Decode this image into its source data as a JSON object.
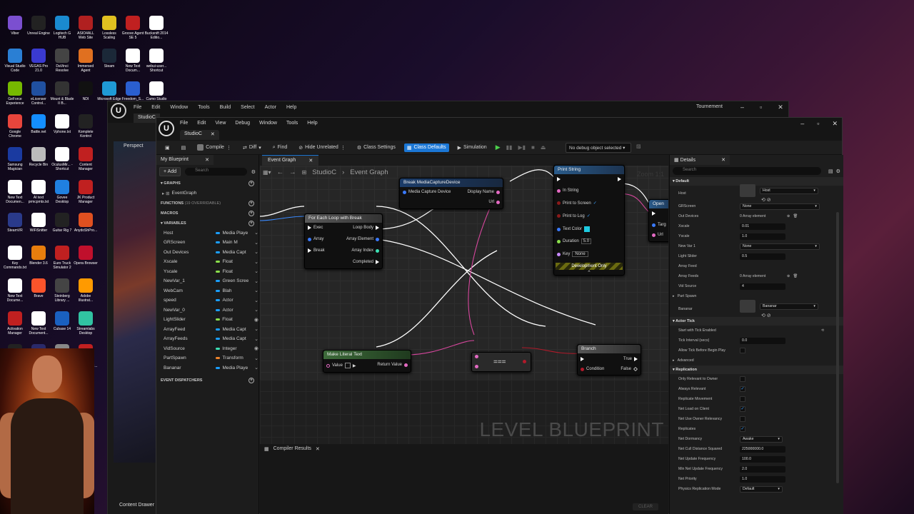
{
  "desktop": {
    "icons": [
      {
        "label": "Viber",
        "color": "#7b4fd0"
      },
      {
        "label": "Unreal Engine",
        "color": "#222222"
      },
      {
        "label": "Logitech G HUB",
        "color": "#1a8ad0"
      },
      {
        "label": "ASIO4ALL Web Site",
        "color": "#b02020"
      },
      {
        "label": "Lossless Scaling",
        "color": "#e0c020"
      },
      {
        "label": "Groove Agent SE 5",
        "color": "#c02020"
      },
      {
        "label": "Bucksnift 2014 Editio...",
        "color": "#ffffff"
      },
      {
        "label": "Visual Studio Code",
        "color": "#2a7fd4"
      },
      {
        "label": "VEGAS Pro 21.0",
        "color": "#3a3ad0"
      },
      {
        "label": "DaVinci Resolve",
        "color": "#444444"
      },
      {
        "label": "Immersed Agent",
        "color": "#e07020"
      },
      {
        "label": "Steam",
        "color": "#1b2838"
      },
      {
        "label": "New Text Docum...",
        "color": "#ffffff"
      },
      {
        "label": "webui-user... Shortcut",
        "color": "#ffffff"
      },
      {
        "label": "GeForce Experience",
        "color": "#76b900"
      },
      {
        "label": "eLicenser Control...",
        "color": "#2050a0"
      },
      {
        "label": "Mount & Blade II B...",
        "color": "#333333"
      },
      {
        "label": "NDI",
        "color": "#111111"
      },
      {
        "label": "Microsoft Edge",
        "color": "#1f9ad6"
      },
      {
        "label": "Freedom_S... Shortcut",
        "color": "#2a5fd0"
      },
      {
        "label": "Camo Studio",
        "color": "#ffffff"
      },
      {
        "label": "Google Chrome",
        "color": "#e8453c"
      },
      {
        "label": "Battle.net",
        "color": "#148eff"
      },
      {
        "label": "Vphone.txt",
        "color": "#ffffff"
      },
      {
        "label": "Komplete Kontrol",
        "color": "#222222"
      },
      {
        "label": "Samsung Magician",
        "color": "#1a3aa0"
      },
      {
        "label": "Recycle Bin",
        "color": "#bbbbbb"
      },
      {
        "label": "OculusMir... - Shortcut",
        "color": "#ffffff"
      },
      {
        "label": "Content Manager",
        "color": "#c02020"
      },
      {
        "label": "New Text Documen...",
        "color": "#ffffff"
      },
      {
        "label": "AI text prmcpmts.txt",
        "color": "#ffffff"
      },
      {
        "label": "Govee Desktop",
        "color": "#2080e0"
      },
      {
        "label": "JK Product Manager",
        "color": "#c02020"
      },
      {
        "label": "SteamVR",
        "color": "#2a3a8a"
      },
      {
        "label": "WiFiSnitter",
        "color": "#ffffff"
      },
      {
        "label": "Guitar Rig 7",
        "color": "#222222"
      },
      {
        "label": "AnydoShPro...",
        "color": "#e05020"
      },
      {
        "label": "Key Commands.txt",
        "color": "#ffffff"
      },
      {
        "label": "Blender 3.6",
        "color": "#e87d0d"
      },
      {
        "label": "Euro Truck Simulator 2",
        "color": "#c02020"
      },
      {
        "label": "Opera Browser",
        "color": "#c0102c"
      },
      {
        "label": "New Text Docume...",
        "color": "#ffffff"
      },
      {
        "label": "Brave",
        "color": "#fb542b"
      },
      {
        "label": "Steinberg Library ...",
        "color": "#444444"
      },
      {
        "label": "Adobe Illustrat...",
        "color": "#ff9a00"
      },
      {
        "label": "Activation Manager",
        "color": "#c02020"
      },
      {
        "label": "New Text Document...",
        "color": "#ffffff"
      },
      {
        "label": "Cubase 14",
        "color": "#1a60c0"
      },
      {
        "label": "Streamlabs Desktop",
        "color": "#31c3a2"
      },
      {
        "label": "Archetype Petrucci X",
        "color": "#222222"
      },
      {
        "label": "Elgato Control...",
        "color": "#2a2a6a"
      },
      {
        "label": "IMG_5059.H...",
        "color": "#888888"
      },
      {
        "label": "SOUND FORGE Audi...",
        "color": "#c02020"
      }
    ]
  },
  "back_window": {
    "menu": [
      "File",
      "Edit",
      "Window",
      "Tools",
      "Build",
      "Select",
      "Actor",
      "Help"
    ],
    "title": "Tournement",
    "tab": "StudioC",
    "viewport_label": "Perspect",
    "content_drawer": "Content Drawer"
  },
  "window": {
    "menu": [
      "File",
      "Edit",
      "View",
      "Debug",
      "Window",
      "Tools",
      "Help"
    ],
    "tab": "StudioC",
    "toolbar": {
      "compile": "Compile",
      "diff": "Diff",
      "find": "Find",
      "hide_unrelated": "Hide Unrelated",
      "class_settings": "Class Settings",
      "class_defaults": "Class Defaults",
      "simulation": "Simulation",
      "debug_object": "No debug object selected"
    }
  },
  "my_blueprint": {
    "tab": "My Blueprint",
    "add": "+ Add",
    "search_placeholder": "Search",
    "graphs_header": "GRAPHS",
    "event_graph": "EventGraph",
    "functions_header": "FUNCTIONS",
    "functions_note": "(19 OVERRIDABLE)",
    "macros_header": "MACROS",
    "variables_header": "VARIABLES",
    "dispatchers_header": "EVENT DISPATCHERS",
    "variables": [
      {
        "name": "Host",
        "type": "Media Playe",
        "color": "#1a9fff",
        "eye": "⌄"
      },
      {
        "name": "GRScreen",
        "type": "Main M",
        "color": "#1a9fff",
        "eye": "⌄"
      },
      {
        "name": "Out Devices",
        "type": "Media Capt",
        "color": "#1a9fff",
        "eye": "⌄"
      },
      {
        "name": "Xscale",
        "type": "Float",
        "color": "#8be04c",
        "eye": "⌄"
      },
      {
        "name": "Yscale",
        "type": "Float",
        "color": "#8be04c",
        "eye": "⌄"
      },
      {
        "name": "NewVar_1",
        "type": "Green Scree",
        "color": "#1a9fff",
        "eye": "⌄"
      },
      {
        "name": "WebCam",
        "type": "Blah",
        "color": "#1a9fff",
        "eye": "⌄"
      },
      {
        "name": "speed",
        "type": "Actor",
        "color": "#1a9fff",
        "eye": "⌄"
      },
      {
        "name": "NewVar_0",
        "type": "Actor",
        "color": "#1a9fff",
        "eye": "⌄"
      },
      {
        "name": "LightSlider",
        "type": "Float",
        "color": "#8be04c",
        "eye": "◉"
      },
      {
        "name": "ArrayFeed",
        "type": "Media Capt",
        "color": "#1a9fff",
        "eye": "⌄"
      },
      {
        "name": "ArrayFeeds",
        "type": "Media Capt",
        "color": "#1a9fff",
        "eye": "⌄"
      },
      {
        "name": "VidSource",
        "type": "Integer",
        "color": "#3ce0b4",
        "eye": "◉"
      },
      {
        "name": "PartSpawn",
        "type": "Transform",
        "color": "#f0842c",
        "eye": "⌄"
      },
      {
        "name": "Bananar",
        "type": "Media Playe",
        "color": "#1a9fff",
        "eye": "⌄"
      }
    ]
  },
  "graph": {
    "tab": "Event Graph",
    "breadcrumb_root": "StudioC",
    "breadcrumb_leaf": "Event Graph",
    "zoom": "Zoom 1:1",
    "level_blueprint": "LEVEL BLUEPRINT",
    "nodes": {
      "break_media": {
        "title": "Break MediaCaptureDevice",
        "in": "Media Capture Device",
        "out1": "Display Name",
        "out2": "Url"
      },
      "for_each": {
        "title": "For Each Loop with Break",
        "in1": "Exec",
        "in2": "Array",
        "in3": "Break",
        "out1": "Loop Body",
        "out2": "Array Element",
        "out3": "Array Index",
        "out4": "Completed"
      },
      "print_string": {
        "title": "Print String",
        "in_string": "In String",
        "print_screen": "Print to Screen",
        "print_log": "Print to Log",
        "text_color": "Text Color",
        "duration": "Duration",
        "duration_val": "5.0",
        "key": "Key",
        "key_val": "None",
        "dev_only": "Development Only"
      },
      "open": {
        "title": "Open",
        "sub": "Targ",
        "pin1": "Targ",
        "pin2": "Url"
      },
      "make_literal": {
        "title": "Make Literal Text",
        "in": "Value",
        "out": "Return Value"
      },
      "equal": {
        "label": "==="
      },
      "branch": {
        "title": "Branch",
        "cond": "Condition",
        "true": "True",
        "false": "False"
      }
    }
  },
  "compiler": {
    "tab": "Compiler Results",
    "clear": "CLEAR"
  },
  "details": {
    "tab": "Details",
    "search_placeholder": "Search",
    "default_header": "Default",
    "host_label": "Host",
    "host_value": "Host",
    "grscreen_label": "GRScreen",
    "grscreen_value": "None",
    "out_devices_label": "Out Devices",
    "out_devices_value": "0 Array element",
    "xscale_label": "Xscale",
    "xscale_value": "0.01",
    "yscale_label": "Yscale",
    "yscale_value": "1.0",
    "newvar_label": "New Var 1",
    "newvar_value": "None",
    "lightslider_label": "Light Slider",
    "lightslider_value": "0.5",
    "arrayfeed_label": "Array Feed",
    "arrayfeeds_label": "Array Feeds",
    "arrayfeeds_value": "0 Array element",
    "vidsource_label": "Vid Source",
    "vidsource_value": "4",
    "partspawn_label": "Part Spawn",
    "bananar_label": "Bananar",
    "bananar_value": "Bananar",
    "actor_tick_header": "Actor Tick",
    "start_tick_label": "Start with Tick Enabled",
    "tick_interval_label": "Tick Interval (secs)",
    "tick_interval_value": "0.0",
    "allow_tick_label": "Allow Tick Before Begin Play",
    "advanced_label": "Advanced",
    "replication_header": "Replication",
    "only_relevant_label": "Only Relevant to Owner",
    "always_relevant_label": "Always Relevant",
    "replicate_movement_label": "Replicate Movement",
    "net_load_label": "Net Load on Client",
    "net_use_owner_label": "Net Use Owner Relevancy",
    "replicates_label": "Replicates",
    "net_dormancy_label": "Net Dormancy",
    "net_dormancy_value": "Awake",
    "net_cull_label": "Net Cull Distance Squared",
    "net_cull_value": "225000000.0",
    "net_update_label": "Net Update Frequency",
    "net_update_value": "100.0",
    "min_net_update_label": "Min Net Update Frequency",
    "min_net_update_value": "2.0",
    "net_priority_label": "Net Priority",
    "net_priority_value": "1.0",
    "phys_rep_label": "Physics Replication Mode",
    "phys_rep_value": "Default"
  }
}
